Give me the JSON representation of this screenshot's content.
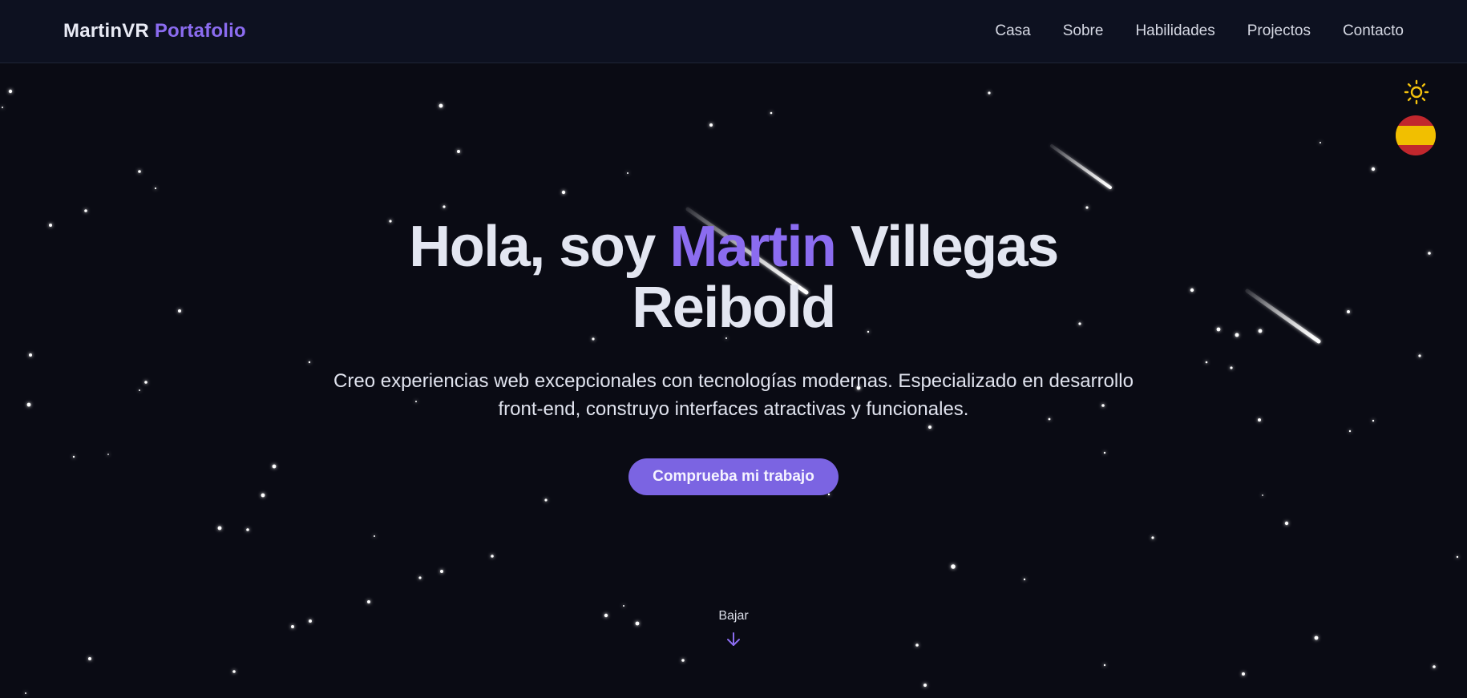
{
  "header": {
    "brand_name": "MartinVR",
    "brand_suffix": "Portafolio",
    "nav": [
      "Casa",
      "Sobre",
      "Habilidades",
      "Projectos",
      "Contacto"
    ]
  },
  "controls": {
    "theme_icon": "sun-icon",
    "language_icon": "spain-flag-icon"
  },
  "hero": {
    "greeting": "Hola, soy",
    "first_name": "Martin",
    "last_name": "Villegas Reibold",
    "subtitle": "Creo experiencias web excepcionales con tecnologías modernas. Especializado en desarrollo front-end, construyo interfaces atractivas y funcionales.",
    "cta_label": "Comprueba mi trabajo"
  },
  "scroll": {
    "label": "Bajar",
    "icon": "arrow-down-icon"
  },
  "colors": {
    "background": "#0a0b14",
    "header": "#0d1120",
    "accent": "#8b6cf0",
    "button": "#7b64e2",
    "sun": "#f4c20d"
  }
}
